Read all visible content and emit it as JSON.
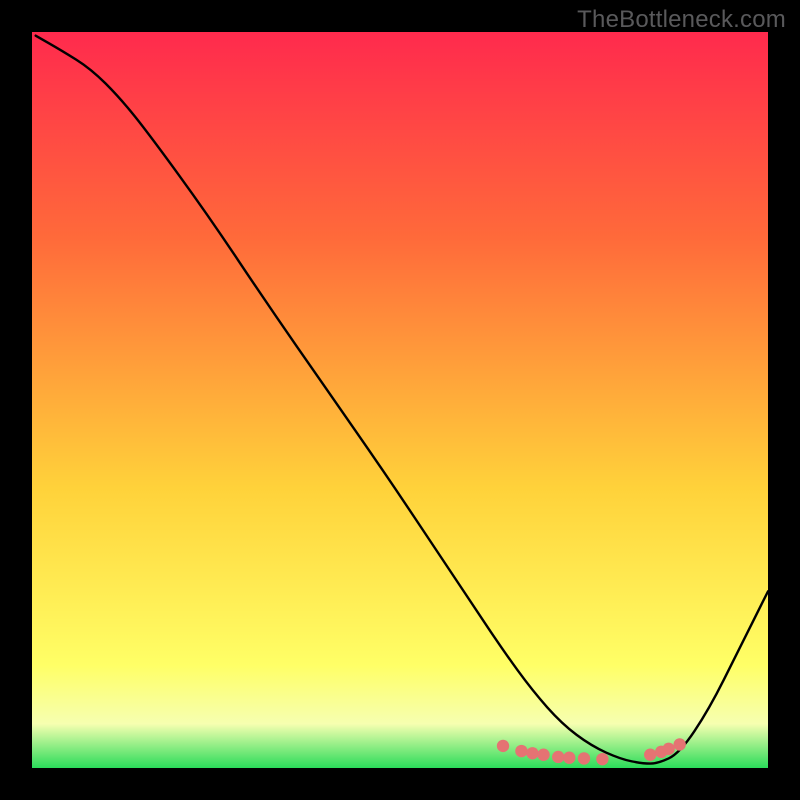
{
  "watermark": "TheBottleneck.com",
  "colors": {
    "frame": "#000000",
    "curve": "#000000",
    "dot": "#e57373",
    "grad_top": "#ff2a4d",
    "grad_mid_upper": "#ff6a3a",
    "grad_mid": "#ffd23a",
    "grad_low": "#ffff66",
    "grad_pale": "#f6ffb0",
    "grad_green": "#2bdc5a"
  },
  "layout": {
    "outer_w": 800,
    "outer_h": 800,
    "inner_x": 32,
    "inner_y": 32,
    "inner_w": 736,
    "inner_h": 736
  },
  "chart_data": {
    "type": "line",
    "title": "",
    "xlabel": "",
    "ylabel": "",
    "xlim": [
      0,
      100
    ],
    "ylim": [
      0,
      100
    ],
    "grid": false,
    "legend": false,
    "series": [
      {
        "name": "curve",
        "x": [
          0.5,
          4,
          8,
          12,
          16,
          24,
          32,
          40,
          48,
          56,
          60,
          64,
          68,
          72,
          76,
          80,
          83,
          85,
          88,
          92,
          96,
          100
        ],
        "y": [
          99.5,
          97.5,
          95,
          91,
          86,
          75,
          63,
          51.5,
          40,
          28,
          22,
          16,
          10.5,
          6,
          3,
          1.2,
          0.6,
          0.6,
          2,
          8,
          16,
          24
        ]
      }
    ],
    "dots": [
      {
        "x": 64.0,
        "y": 3.0
      },
      {
        "x": 66.5,
        "y": 2.3
      },
      {
        "x": 68.0,
        "y": 2.0
      },
      {
        "x": 69.5,
        "y": 1.8
      },
      {
        "x": 71.5,
        "y": 1.5
      },
      {
        "x": 73.0,
        "y": 1.4
      },
      {
        "x": 75.0,
        "y": 1.3
      },
      {
        "x": 77.5,
        "y": 1.2
      },
      {
        "x": 84.0,
        "y": 1.8
      },
      {
        "x": 85.5,
        "y": 2.2
      },
      {
        "x": 86.5,
        "y": 2.6
      },
      {
        "x": 88.0,
        "y": 3.2
      }
    ]
  }
}
